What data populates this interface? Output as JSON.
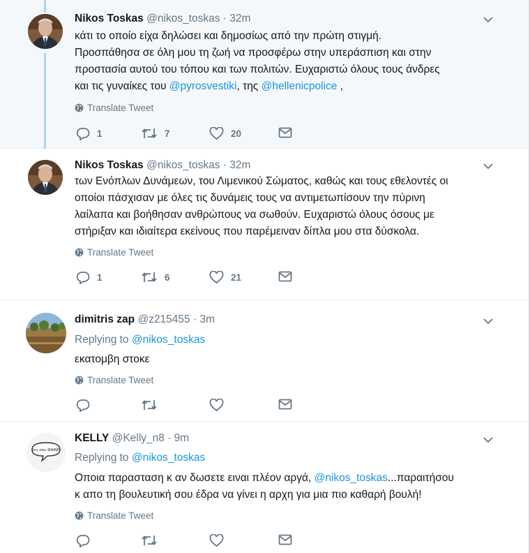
{
  "tweets": [
    {
      "name": "Nikos Toskas",
      "handle": "@nikos_toskas",
      "time": "· 32m",
      "lines": [
        [
          {
            "t": "κάτι το οποίο είχα δηλώσει και δημοσίως από την πρώτη στιγμή."
          }
        ],
        [
          {
            "t": "Προσπάθησα σε όλη μου τη ζωή να προσφέρω στην υπεράσπιση και στην"
          }
        ],
        [
          {
            "t": "προστασία αυτού του τόπου και των πολιτών. Ευχαριστώ όλους τους άνδρες"
          }
        ],
        [
          {
            "t": "και τις γυναίκες του "
          },
          {
            "t": "@pyrosvestiki",
            "link": true
          },
          {
            "t": ", της "
          },
          {
            "t": "@hellenicpolice",
            "link": true
          },
          {
            "t": " ,"
          }
        ]
      ],
      "translate": "Translate Tweet",
      "replies": "1",
      "retweets": "7",
      "likes": "20"
    },
    {
      "name": "Nikos Toskas",
      "handle": "@nikos_toskas",
      "time": "· 32m",
      "lines": [
        [
          {
            "t": "των Ενόπλων Δυνάμεων, του Λιμενικού Σώματος, καθώς και τους εθελοντές οι"
          }
        ],
        [
          {
            "t": "οποίοι πάσχισαν με όλες τις δυνάμεις τους να αντιμετωπίσουν την πύρινη"
          }
        ],
        [
          {
            "t": "λαίλαπα και βοήθησαν ανθρώπους να σωθούν. Ευχαριστώ όλους όσους με"
          }
        ],
        [
          {
            "t": "στήριξαν και ιδιαίτερα εκείνους που παρέμειναν δίπλα μου στα δύσκολα."
          }
        ]
      ],
      "translate": "Translate Tweet",
      "replies": "1",
      "retweets": "6",
      "likes": "21"
    },
    {
      "name": "dimitris zap",
      "handle": "@z215455",
      "time": "· 3m",
      "replying_prefix": "Replying to ",
      "replying_handle": "@nikos_toskas",
      "lines": [
        [
          {
            "t": "εκατομβη στοκε"
          }
        ]
      ],
      "translate": "Translate Tweet",
      "replies": "",
      "retweets": "",
      "likes": ""
    },
    {
      "name": "KELLY",
      "handle": "@Kelly_n8",
      "time": "· 9m",
      "replying_prefix": "Replying to ",
      "replying_handle": "@nikos_toskas",
      "lines": [
        [
          {
            "t": "Οποια παρασταση κ αν δωσετε ειναι πλέον αργά, "
          },
          {
            "t": "@nikos_toskas",
            "link": true
          },
          {
            "t": "...παραιτήσου"
          }
        ],
        [
          {
            "t": "κ απο τη βουλευτική σου έδρα να γίνει η αρχη για μια πιο καθαρή βουλή!"
          }
        ]
      ],
      "translate": "Translate Tweet",
      "replies": "",
      "retweets": "",
      "likes": ""
    }
  ],
  "avatar_badge_text": "δεν σου ΦΑΙΝΕΙ",
  "colors": {
    "link": "#1b95e0",
    "muted": "#657786",
    "thread": "#a9d4f5",
    "highlight_bg": "#f5f8fa"
  }
}
